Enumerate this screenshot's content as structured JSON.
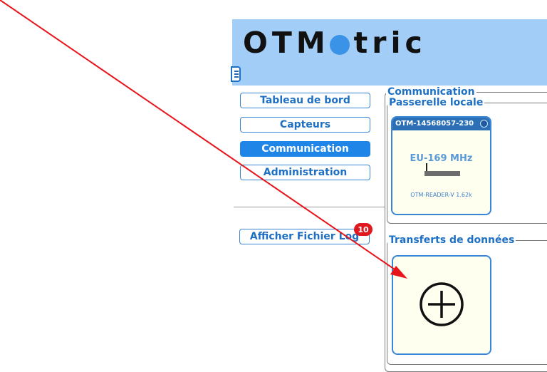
{
  "header": {
    "logo_text": "OTMetric",
    "logo_part1": "OTM",
    "logo_part2": "tric"
  },
  "sidebar": {
    "items": [
      {
        "label": "Tableau de bord",
        "active": false
      },
      {
        "label": "Capteurs",
        "active": false
      },
      {
        "label": "Communication",
        "active": true
      },
      {
        "label": "Administration",
        "active": false
      }
    ],
    "log_button": {
      "label": "Afficher Fichier Log",
      "badge": "10"
    }
  },
  "main": {
    "section_title": "Communication",
    "local_gateway": {
      "legend": "Passerelle locale",
      "card": {
        "id": "OTM-14568057-230",
        "frequency": "EU-169 MHz",
        "version": "OTM-READER-V 1.62k"
      }
    },
    "data_transfers": {
      "legend": "Transferts de données",
      "add_icon": "plus-circle-icon"
    }
  },
  "colors": {
    "header_bg": "#a2cdf7",
    "accent": "#1f86e8",
    "badge": "#e0191f",
    "arrow": "#e8141b",
    "card_bg": "#fffff0"
  }
}
